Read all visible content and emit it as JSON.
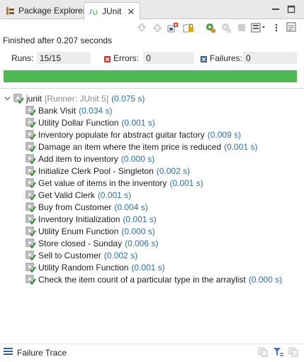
{
  "tabs": {
    "package_explorer": "Package Explorer",
    "junit": "JUnit"
  },
  "status_text": "Finished after 0.207 seconds",
  "counters": {
    "runs_label": "Runs:",
    "runs_value": "15/15",
    "errors_label": "Errors:",
    "errors_value": "0",
    "failures_label": "Failures:",
    "failures_value": "0"
  },
  "progress": {
    "fraction": 1.0,
    "color": "#4fb74f"
  },
  "tree": {
    "root": {
      "name": "junit",
      "runner": "[Runner: JUnit 5]",
      "time": "(0.075 s)"
    },
    "tests": [
      {
        "name": "Bank Visit",
        "time": "(0.034 s)"
      },
      {
        "name": "Utility Dollar Function",
        "time": "(0.001 s)"
      },
      {
        "name": "Inventory populate for abstract guitar factory",
        "time": "(0.009 s)"
      },
      {
        "name": "Damage an item where the item price is reduced",
        "time": "(0.001 s)"
      },
      {
        "name": "Add item to inventory",
        "time": "(0.000 s)"
      },
      {
        "name": "Initialize Clerk Pool - Singleton",
        "time": "(0.002 s)"
      },
      {
        "name": "Get value of items in the inventory",
        "time": "(0.001 s)"
      },
      {
        "name": "Get Valid Clerk",
        "time": "(0.001 s)"
      },
      {
        "name": "Buy from Customer",
        "time": "(0.004 s)"
      },
      {
        "name": "Inventory Initialization",
        "time": "(0.001 s)"
      },
      {
        "name": "Utility Enum Function",
        "time": "(0.000 s)"
      },
      {
        "name": "Store closed - Sunday",
        "time": "(0.006 s)"
      },
      {
        "name": "Sell to Customer",
        "time": "(0.002 s)"
      },
      {
        "name": "Utility Random Function",
        "time": "(0.001 s)"
      },
      {
        "name": "Check the item count of a particular type in the arraylist",
        "time": "(0.000 s)"
      }
    ]
  },
  "failure_trace_label": "Failure Trace",
  "colors": {
    "success_green": "#4fb74f",
    "time_blue": "#2f6f9f",
    "runner_gray": "#888888"
  },
  "icons": [
    "package-explorer-icon",
    "junit-icon",
    "close-icon",
    "minimize-icon",
    "maximize-icon",
    "next-failure-icon",
    "previous-failure-icon",
    "show-failures-only-icon",
    "scroll-lock-icon",
    "rerun-icon",
    "rerun-failed-first-icon",
    "stop-icon",
    "history-icon",
    "view-menu-icon",
    "collapse-tree-icon",
    "error-icon",
    "failure-icon",
    "test-suite-icon",
    "test-passed-icon",
    "failure-trace-icon",
    "compare-icon",
    "filter-trace-icon",
    "copy-trace-icon"
  ]
}
